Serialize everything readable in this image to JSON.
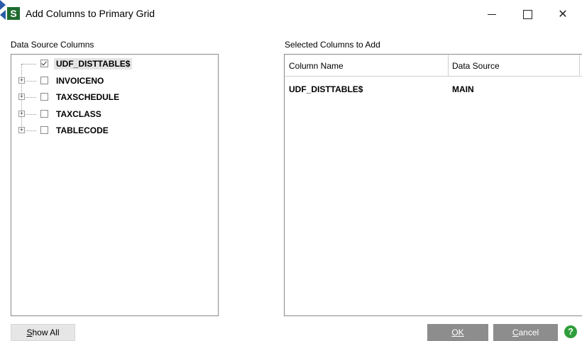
{
  "window": {
    "title": "Add Columns to Primary Grid",
    "icon_letter": "S",
    "minimize_glyph": "—",
    "maximize_glyph": "☐",
    "close_glyph": "✕"
  },
  "left": {
    "label": "Data Source Columns",
    "tree": [
      {
        "label": "UDF_DISTTABLE$",
        "checked": true,
        "expandable": false,
        "selected": true
      },
      {
        "label": "INVOICENO",
        "checked": false,
        "expandable": true,
        "selected": false
      },
      {
        "label": "TAXSCHEDULE",
        "checked": false,
        "expandable": true,
        "selected": false
      },
      {
        "label": "TAXCLASS",
        "checked": false,
        "expandable": true,
        "selected": false
      },
      {
        "label": "TABLECODE",
        "checked": false,
        "expandable": true,
        "selected": false
      }
    ]
  },
  "right": {
    "label": "Selected Columns to Add",
    "columns": [
      "Column Name",
      "Data Source"
    ],
    "rows": [
      {
        "column_name": "UDF_DISTTABLE$",
        "data_source": "MAIN"
      }
    ]
  },
  "buttons": {
    "show_all_prefix": "S",
    "show_all_rest": "how All",
    "ok": "OK",
    "cancel_prefix": "C",
    "cancel_rest": "ancel",
    "help": "?"
  },
  "icons": {
    "add": "arrow-right-icon",
    "remove": "arrow-left-icon"
  },
  "colors": {
    "arrow": "#2b5ca8",
    "button_disabled": "#8d8d8d",
    "help": "#2e9e3a",
    "app_icon": "#1e6b2e"
  }
}
